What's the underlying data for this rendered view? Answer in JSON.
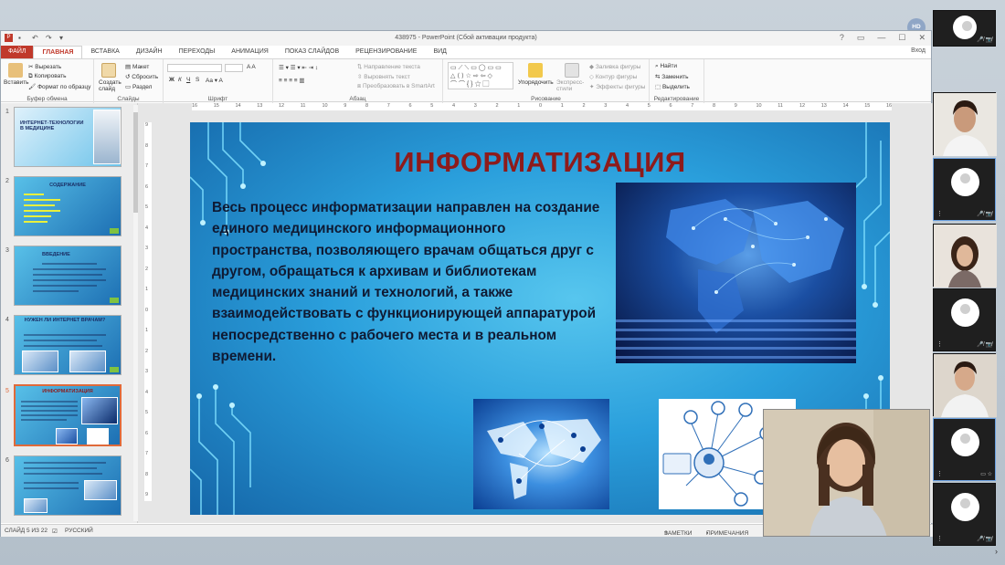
{
  "window": {
    "title": "438975 - PowerPoint (Сбой активации продукта)",
    "signin": "Вход",
    "controls": [
      "?",
      "▭",
      "—",
      "☐",
      "✕"
    ]
  },
  "tabs": [
    {
      "label": "ФАЙЛ"
    },
    {
      "label": "ГЛАВНАЯ"
    },
    {
      "label": "ВСТАВКА"
    },
    {
      "label": "ДИЗАЙН"
    },
    {
      "label": "ПЕРЕХОДЫ"
    },
    {
      "label": "АНИМАЦИЯ"
    },
    {
      "label": "ПОКАЗ СЛАЙДОВ"
    },
    {
      "label": "РЕЦЕНЗИРОВАНИЕ"
    },
    {
      "label": "ВИД"
    }
  ],
  "ribbon": {
    "clipboard": {
      "label": "Буфер обмена",
      "paste": "Вставить",
      "cut": "Вырезать",
      "copy": "Копировать",
      "format_painter": "Формат по образцу"
    },
    "slides": {
      "label": "Слайды",
      "new_slide": "Создать слайд",
      "layout": "Макет",
      "reset": "Сбросить",
      "section": "Раздел"
    },
    "font": {
      "label": "Шрифт"
    },
    "paragraph": {
      "label": "Абзац",
      "text_direction": "Направление текста",
      "align_text": "Выровнять текст",
      "smartart": "Преобразовать в SmartArt"
    },
    "drawing": {
      "label": "Рисование",
      "arrange": "Упорядочить",
      "quick_styles": "Экспресс-стили",
      "shape_fill": "Заливка фигуры",
      "shape_outline": "Контур фигуры",
      "shape_effects": "Эффекты фигуры"
    },
    "editing": {
      "label": "Редактирование",
      "find": "Найти",
      "replace": "Заменить",
      "select": "Выделить"
    }
  },
  "ruler_h": [
    "16",
    "15",
    "14",
    "13",
    "12",
    "11",
    "10",
    "9",
    "8",
    "7",
    "6",
    "5",
    "4",
    "3",
    "2",
    "1",
    "0",
    "1",
    "2",
    "3",
    "4",
    "5",
    "6",
    "7",
    "8",
    "9",
    "10",
    "11",
    "12",
    "13",
    "14",
    "15",
    "16"
  ],
  "ruler_v": [
    "9",
    "8",
    "7",
    "6",
    "5",
    "4",
    "3",
    "2",
    "1",
    "0",
    "1",
    "2",
    "3",
    "4",
    "5",
    "6",
    "7",
    "8",
    "9"
  ],
  "thumbnails": [
    {
      "num": "1",
      "title": "ИНТЕРНЕТ-ТЕХНОЛОГИИ В МЕДИЦИНЕ"
    },
    {
      "num": "2",
      "title": "СОДЕРЖАНИЕ"
    },
    {
      "num": "3",
      "title": "ВВЕДЕНИЕ"
    },
    {
      "num": "4",
      "title": "НУЖЕН ЛИ ИНТЕРНЕТ ВРАЧАМ?"
    },
    {
      "num": "5",
      "title": "ИНФОРМАТИЗАЦИЯ"
    },
    {
      "num": "6",
      "title": ""
    }
  ],
  "slide": {
    "title": "ИНФОРМАТИЗАЦИЯ",
    "body": "Весь процесс информатизации направлен на создание единого медицинского информационного пространства, позволяющего врачам общаться друг с другом, обращаться к архивам и библиотекам медицинских знаний и технологий, а также взаимодействовать с функционирующей аппаратурой непосредственно с рабочего места и в реальном времени."
  },
  "status": {
    "slide_of": "СЛАЙД 5 ИЗ 22",
    "language": "РУССКИЙ",
    "notes": "ЗАМЕТКИ",
    "comments": "ПРИМЕЧАНИЯ"
  },
  "participants": {
    "host_initials": "HD",
    "tile_icons": "🎤̸ 📷̸"
  }
}
